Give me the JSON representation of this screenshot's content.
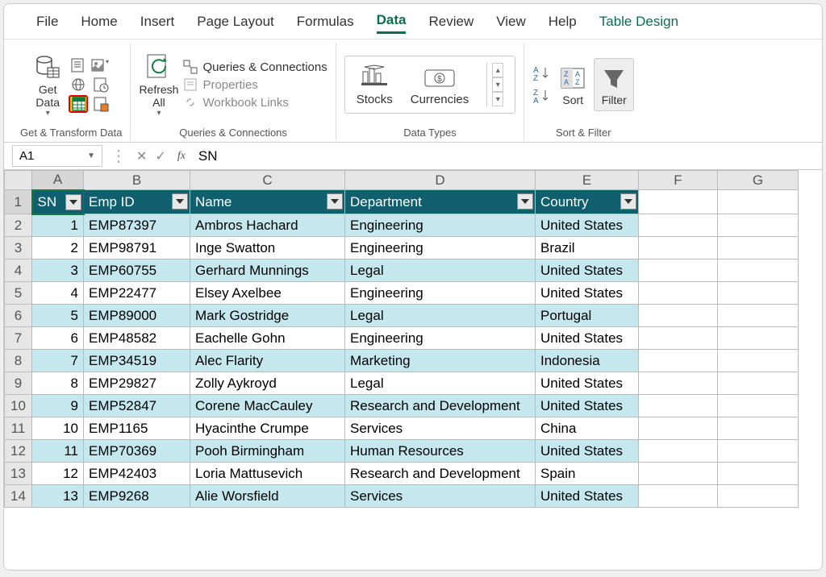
{
  "tabs": [
    "File",
    "Home",
    "Insert",
    "Page Layout",
    "Formulas",
    "Data",
    "Review",
    "View",
    "Help",
    "Table Design"
  ],
  "active_tab": "Data",
  "ribbon": {
    "get_data": "Get\nData",
    "get_data_group": "Get & Transform Data",
    "refresh_all": "Refresh\nAll",
    "qc_queries": "Queries & Connections",
    "qc_props": "Properties",
    "qc_links": "Workbook Links",
    "qc_group": "Queries & Connections",
    "stocks": "Stocks",
    "currencies": "Currencies",
    "datatypes_group": "Data Types",
    "sort": "Sort",
    "filter": "Filter",
    "sort_filter_group": "Sort & Filter"
  },
  "namebox": "A1",
  "formula": "SN",
  "headers": {
    "sn": "SN",
    "emp": "Emp ID",
    "name": "Name",
    "dept": "Department",
    "country": "Country"
  },
  "rows": [
    {
      "sn": 1,
      "emp": "EMP87397",
      "name": "Ambros Hachard",
      "dept": "Engineering",
      "country": "United States"
    },
    {
      "sn": 2,
      "emp": "EMP98791",
      "name": "Inge Swatton",
      "dept": "Engineering",
      "country": "Brazil"
    },
    {
      "sn": 3,
      "emp": "EMP60755",
      "name": "Gerhard Munnings",
      "dept": "Legal",
      "country": "United States"
    },
    {
      "sn": 4,
      "emp": "EMP22477",
      "name": "Elsey Axelbee",
      "dept": "Engineering",
      "country": "United States"
    },
    {
      "sn": 5,
      "emp": "EMP89000",
      "name": "Mark Gostridge",
      "dept": "Legal",
      "country": "Portugal"
    },
    {
      "sn": 6,
      "emp": "EMP48582",
      "name": "Eachelle Gohn",
      "dept": "Engineering",
      "country": "United States"
    },
    {
      "sn": 7,
      "emp": "EMP34519",
      "name": "Alec Flarity",
      "dept": "Marketing",
      "country": "Indonesia"
    },
    {
      "sn": 8,
      "emp": "EMP29827",
      "name": "Zolly Aykroyd",
      "dept": "Legal",
      "country": "United States"
    },
    {
      "sn": 9,
      "emp": "EMP52847",
      "name": "Corene MacCauley",
      "dept": "Research and Development",
      "country": "United States"
    },
    {
      "sn": 10,
      "emp": "EMP1165",
      "name": "Hyacinthe Crumpe",
      "dept": "Services",
      "country": "China"
    },
    {
      "sn": 11,
      "emp": "EMP70369",
      "name": "Pooh Birmingham",
      "dept": "Human Resources",
      "country": "United States"
    },
    {
      "sn": 12,
      "emp": "EMP42403",
      "name": "Loria Mattusevich",
      "dept": "Research and Development",
      "country": "Spain"
    },
    {
      "sn": 13,
      "emp": "EMP9268",
      "name": "Alie Worsfield",
      "dept": "Services",
      "country": "United States"
    }
  ],
  "col_letters": [
    "A",
    "B",
    "C",
    "D",
    "E",
    "F",
    "G"
  ]
}
